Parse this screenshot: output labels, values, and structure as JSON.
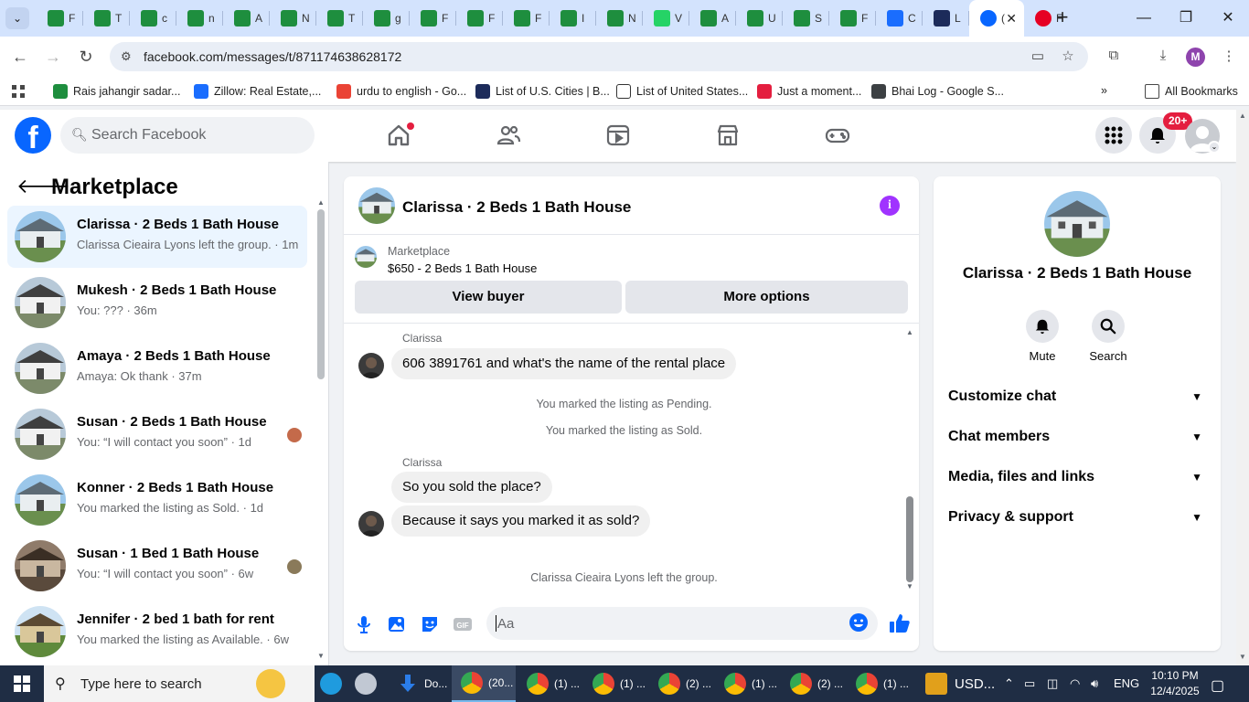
{
  "browser": {
    "tab_menu_icon": "chevron-down-icon",
    "tabs": [
      {
        "label": "F",
        "icon": "sheets-icon",
        "color": "#1e8e3e"
      },
      {
        "label": "T",
        "icon": "sheets-icon",
        "color": "#1e8e3e"
      },
      {
        "label": "c",
        "icon": "sheets-icon",
        "color": "#1e8e3e"
      },
      {
        "label": "n",
        "icon": "sheets-icon",
        "color": "#1e8e3e"
      },
      {
        "label": "A",
        "icon": "sheets-icon",
        "color": "#1e8e3e"
      },
      {
        "label": "N",
        "icon": "sheets-icon",
        "color": "#1e8e3e"
      },
      {
        "label": "T",
        "icon": "sheets-icon",
        "color": "#1e8e3e"
      },
      {
        "label": "g",
        "icon": "sheets-icon",
        "color": "#1e8e3e"
      },
      {
        "label": "F",
        "icon": "sheets-icon",
        "color": "#1e8e3e"
      },
      {
        "label": "F",
        "icon": "sheets-icon",
        "color": "#1e8e3e"
      },
      {
        "label": "F",
        "icon": "sheets-icon",
        "color": "#1e8e3e"
      },
      {
        "label": "I",
        "icon": "sheets-icon",
        "color": "#1e8e3e"
      },
      {
        "label": "N",
        "icon": "sheets-icon",
        "color": "#1e8e3e"
      },
      {
        "label": "V",
        "icon": "whatsapp-icon",
        "color": "#25d366"
      },
      {
        "label": "A",
        "icon": "sheets-icon",
        "color": "#1e8e3e"
      },
      {
        "label": "U",
        "icon": "sheets-icon",
        "color": "#1e8e3e"
      },
      {
        "label": "S",
        "icon": "sheets-icon",
        "color": "#1e8e3e"
      },
      {
        "label": "F",
        "icon": "sheets-icon",
        "color": "#1e8e3e"
      },
      {
        "label": "C",
        "icon": "zillow-icon",
        "color": "#1a6dfe"
      },
      {
        "label": "L",
        "icon": "flag-icon",
        "color": "#1c2b5a"
      }
    ],
    "active_tab": {
      "label": "(",
      "icon": "facebook-icon"
    },
    "last_tab": {
      "label": "F",
      "icon": "pinterest-icon",
      "color": "#e60023"
    },
    "new_tab_icon": "plus-icon",
    "address": "facebook.com/messages/t/871174638628172",
    "profile_initial": "M",
    "bookmarks": [
      {
        "label": "Rais jahangir sadar...",
        "icon": "sheets-icon",
        "color": "#1e8e3e"
      },
      {
        "label": "Zillow: Real Estate,...",
        "icon": "zillow-icon",
        "color": "#1a6dfe"
      },
      {
        "label": "urdu to english - Go...",
        "icon": "google-icon",
        "color": "#ea4335"
      },
      {
        "label": "List of U.S. Cities | B...",
        "icon": "flag-icon",
        "color": "#1c2b5a"
      },
      {
        "label": "List of United States...",
        "icon": "wikipedia-icon",
        "color": "#ffffff"
      },
      {
        "label": "Just a moment...",
        "icon": "fiverr-icon",
        "color": "#e41e3f"
      },
      {
        "label": "Bhai Log - Google S...",
        "icon": "globe-icon",
        "color": "#3c4043"
      }
    ],
    "all_bookmarks": "All Bookmarks"
  },
  "fb": {
    "search_placeholder": "Search Facebook",
    "notification_count": "20+",
    "brand_color": "#0866ff"
  },
  "sidebar": {
    "title": "Marketplace",
    "conversations": [
      {
        "name": "Clarissa · 2 Beds 1 Bath House",
        "preview": "Clarissa Cieaira Lyons left the group. · 1m",
        "active": true
      },
      {
        "name": "Mukesh · 2 Beds 1 Bath House",
        "preview": "You: ??? · 36m"
      },
      {
        "name": "Amaya · 2 Beds 1 Bath House",
        "preview": "Amaya: Ok thank · 37m"
      },
      {
        "name": "Susan · 2 Beds 1 Bath House",
        "preview": "You: “I will contact you soon” · 1d"
      },
      {
        "name": "Konner · 2 Beds 1 Bath House",
        "preview": "You marked the listing as Sold. · 1d"
      },
      {
        "name": "Susan · 1 Bed 1 Bath House",
        "preview": "You: “I will contact you soon” · 6w"
      },
      {
        "name": "Jennifer · 2 bed 1 bath for rent",
        "preview": "You marked the listing as Available. · 6w"
      }
    ]
  },
  "chat": {
    "title": "Clarissa · 2 Beds 1 Bath House",
    "listing_source": "Marketplace",
    "listing_title": "$650 - 2 Beds 1 Bath House",
    "view_buyer": "View buyer",
    "more_options": "More options",
    "messages": {
      "sender1": "Clarissa",
      "msg1": "606 3891761 and what's the name of the rental place",
      "sys1": "You marked the listing as Pending.",
      "sys2": "You marked the listing as Sold.",
      "sender2": "Clarissa",
      "msg2": "So you sold the place?",
      "msg3": "Because it says you marked it as sold?",
      "sys3": "Clarissa Cieaira Lyons left the group."
    },
    "composer_placeholder": "Aa",
    "gif_label": "GIF",
    "accent": "#0866ff"
  },
  "info_panel": {
    "name": "Clarissa · 2 Beds 1 Bath House",
    "mute": "Mute",
    "search": "Search",
    "sections": [
      "Customize chat",
      "Chat members",
      "Media, files and links",
      "Privacy & support"
    ]
  },
  "taskbar": {
    "search_placeholder": "Type here to search",
    "apps": [
      {
        "label": "Do...",
        "icon": "download-icon"
      },
      {
        "label": "(20...",
        "icon": "chrome-icon",
        "active": true
      },
      {
        "label": "(1) ...",
        "icon": "chrome-icon"
      },
      {
        "label": "(1) ...",
        "icon": "chrome-icon"
      },
      {
        "label": "(2) ...",
        "icon": "chrome-icon"
      },
      {
        "label": "(1) ...",
        "icon": "chrome-icon"
      },
      {
        "label": "(2) ...",
        "icon": "chrome-icon"
      },
      {
        "label": "(1) ...",
        "icon": "chrome-icon"
      }
    ],
    "currency": "USD...",
    "language": "ENG",
    "time": "10:10 PM",
    "date": "12/4/2025"
  }
}
